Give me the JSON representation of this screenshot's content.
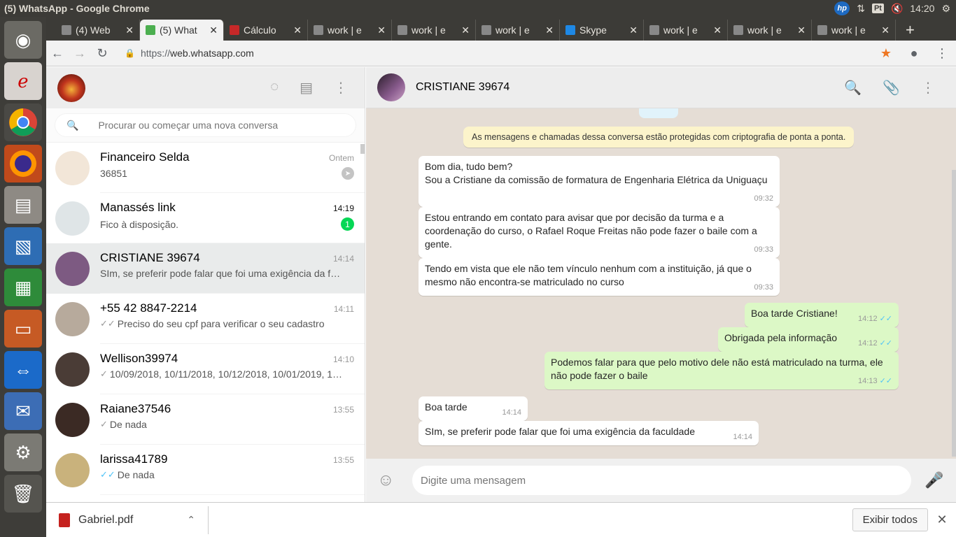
{
  "os": {
    "window_title": "(5) WhatsApp - Google Chrome",
    "lang": "Pt",
    "clock": "14:20"
  },
  "browser": {
    "tabs": [
      {
        "title": "(4) Web",
        "icon": "page-icon",
        "color": "#888888"
      },
      {
        "title": "(5) What",
        "icon": "whatsapp-icon",
        "color": "#4caf50",
        "active": true
      },
      {
        "title": "Cálculo",
        "icon": "ce-icon",
        "color": "#c62828"
      },
      {
        "title": "work | e",
        "icon": "page-icon",
        "color": "#888888"
      },
      {
        "title": "work | e",
        "icon": "page-icon",
        "color": "#888888"
      },
      {
        "title": "work | e",
        "icon": "page-icon",
        "color": "#888888"
      },
      {
        "title": "Skype",
        "icon": "skype-icon",
        "color": "#1e88e5"
      },
      {
        "title": "work | e",
        "icon": "page-icon",
        "color": "#888888"
      },
      {
        "title": "work | e",
        "icon": "page-icon",
        "color": "#888888"
      },
      {
        "title": "work | e",
        "icon": "page-icon",
        "color": "#888888"
      }
    ],
    "url_proto": "https://",
    "url_host": "web.whatsapp.com"
  },
  "sidebar": {
    "search_placeholder": "Procurar ou começar uma nova conversa",
    "chats": [
      {
        "name": "Financeiro Selda",
        "time": "Ontem",
        "preview": "36851",
        "tick": "",
        "pinned": true,
        "avatar_color": "#f2e6d8"
      },
      {
        "name": "Manassés link",
        "time": "14:19",
        "preview": "Fico à disposição.",
        "tick": "",
        "unread": "1",
        "avatar_color": "#dfe5e7"
      },
      {
        "name": "CRISTIANE 39674",
        "time": "14:14",
        "preview": "SIm, se preferir pode falar que foi uma exigência da f…",
        "tick": "",
        "selected": true,
        "avatar_color": "#7d5a82"
      },
      {
        "name": "+55 42 8847-2214",
        "time": "14:11",
        "preview": "Preciso do seu cpf para verificar o seu cadastro",
        "tick": "✓✓",
        "avatar_color": "#b7aa9c"
      },
      {
        "name": "Wellison39974",
        "time": "14:10",
        "preview": "10/09/2018, 10/11/2018, 10/12/2018, 10/01/2019, 1…",
        "tick": "✓",
        "avatar_color": "#4a3c36"
      },
      {
        "name": "Raiane37546",
        "time": "13:55",
        "preview": "De nada",
        "tick": "✓",
        "avatar_color": "#3b2a24"
      },
      {
        "name": "larissa41789",
        "time": "13:55",
        "preview": "De nada",
        "tick": "✓✓",
        "tick_blue": true,
        "avatar_color": "#c9b27c"
      }
    ]
  },
  "conversation": {
    "title": "CRISTIANE 39674",
    "system_notice": "As mensagens e chamadas dessa conversa estão protegidas com criptografia de ponta a ponta.",
    "messages": [
      {
        "dir": "in",
        "text": "Bom dia, tudo bem?\nSou a Cristiane da comissão de formatura de Engenharia Elétrica da Uniguaçu",
        "time": "09:32"
      },
      {
        "dir": "in",
        "text": "Estou entrando em contato para avisar que por decisão da turma e a coordenação do curso, o Rafael Roque Freitas não pode fazer o baile com a gente.",
        "time": "09:33"
      },
      {
        "dir": "in",
        "text": "Tendo em vista que ele não tem vínculo nenhum com a instituição, já que o mesmo não encontra-se matriculado no curso",
        "time": "09:33"
      },
      {
        "dir": "out",
        "text": "Boa tarde Cristiane!",
        "time": "14:12"
      },
      {
        "dir": "out",
        "text": "Obrigada pela informação",
        "time": "14:12"
      },
      {
        "dir": "out",
        "text": "Podemos falar para que pelo motivo dele não está matriculado na turma, ele não pode fazer o baile",
        "time": "14:13"
      },
      {
        "dir": "in",
        "text": "Boa tarde",
        "time": "14:14"
      },
      {
        "dir": "in",
        "text": "SIm, se preferir pode falar que foi uma exigência da faculdade",
        "time": "14:14"
      }
    ],
    "compose_placeholder": "Digite uma mensagem"
  },
  "downloads": {
    "file": "Gabriel.pdf",
    "show_all": "Exibir todos"
  }
}
